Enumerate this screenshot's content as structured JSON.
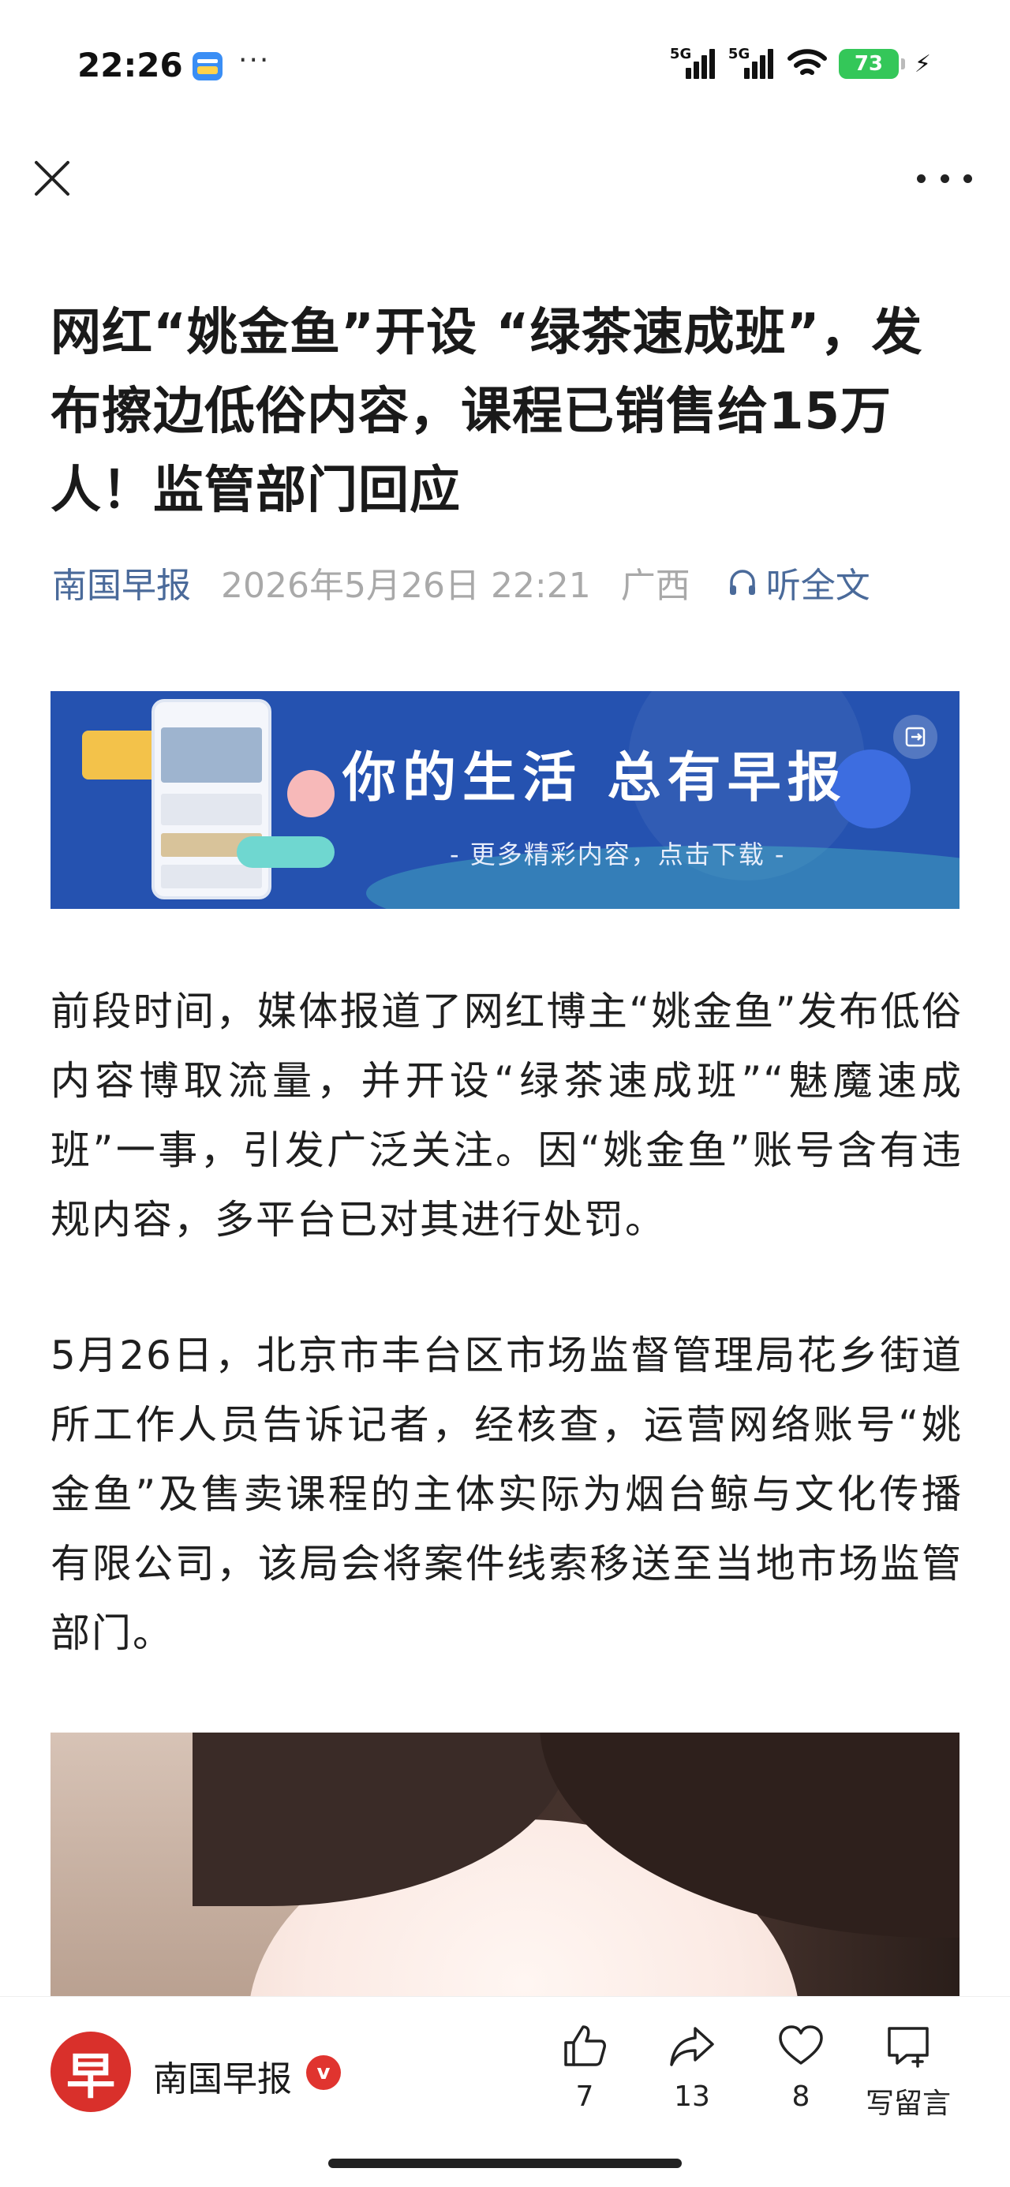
{
  "status": {
    "time": "22:26",
    "dots": "···",
    "signal1": "5G",
    "signal2": "5G",
    "battery": "73"
  },
  "nav": {
    "close_icon": "close-icon",
    "more_icon": "more-icon"
  },
  "article": {
    "title": "网红“姚金鱼”开设 “绿茶速成班”，发布擦边低俗内容，课程已销售给15万人！监管部门回应",
    "source": "南国早报",
    "datetime": "2026年5月26日 22:21",
    "region": "广西",
    "listen_label": "听全文",
    "paragraphs": [
      "前段时间，媒体报道了网红博主“姚金鱼”发布低俗内容博取流量，并开设“绿茶速成班”“魅魔速成班”一事，引发广泛关注。因“姚金鱼”账号含有违规内容，多平台已对其进行处罚。",
      "5月26日，北京市丰台区市场监督管理局花乡街道所工作人员告诉记者，经核查，运营网络账号“姚金鱼”及售卖课程的主体实际为烟台鲸与文化传播有限公司，该局会将案件线索移送至当地市场监管部门。"
    ]
  },
  "banner": {
    "slogan": "你的生活 总有早报",
    "subtitle": "- 更多精彩内容，点击下载 -"
  },
  "bottom_bar": {
    "avatar_char": "早",
    "account_name": "南国早报",
    "verified": "v",
    "like_count": "7",
    "share_count": "13",
    "fav_count": "8",
    "comment_label": "写留言"
  },
  "colors": {
    "source_blue": "#4a6a9a",
    "meta_gray": "#a9a9a9",
    "banner_blue": "#2552b0",
    "brand_red": "#d9302b",
    "battery_green": "#34c759"
  }
}
